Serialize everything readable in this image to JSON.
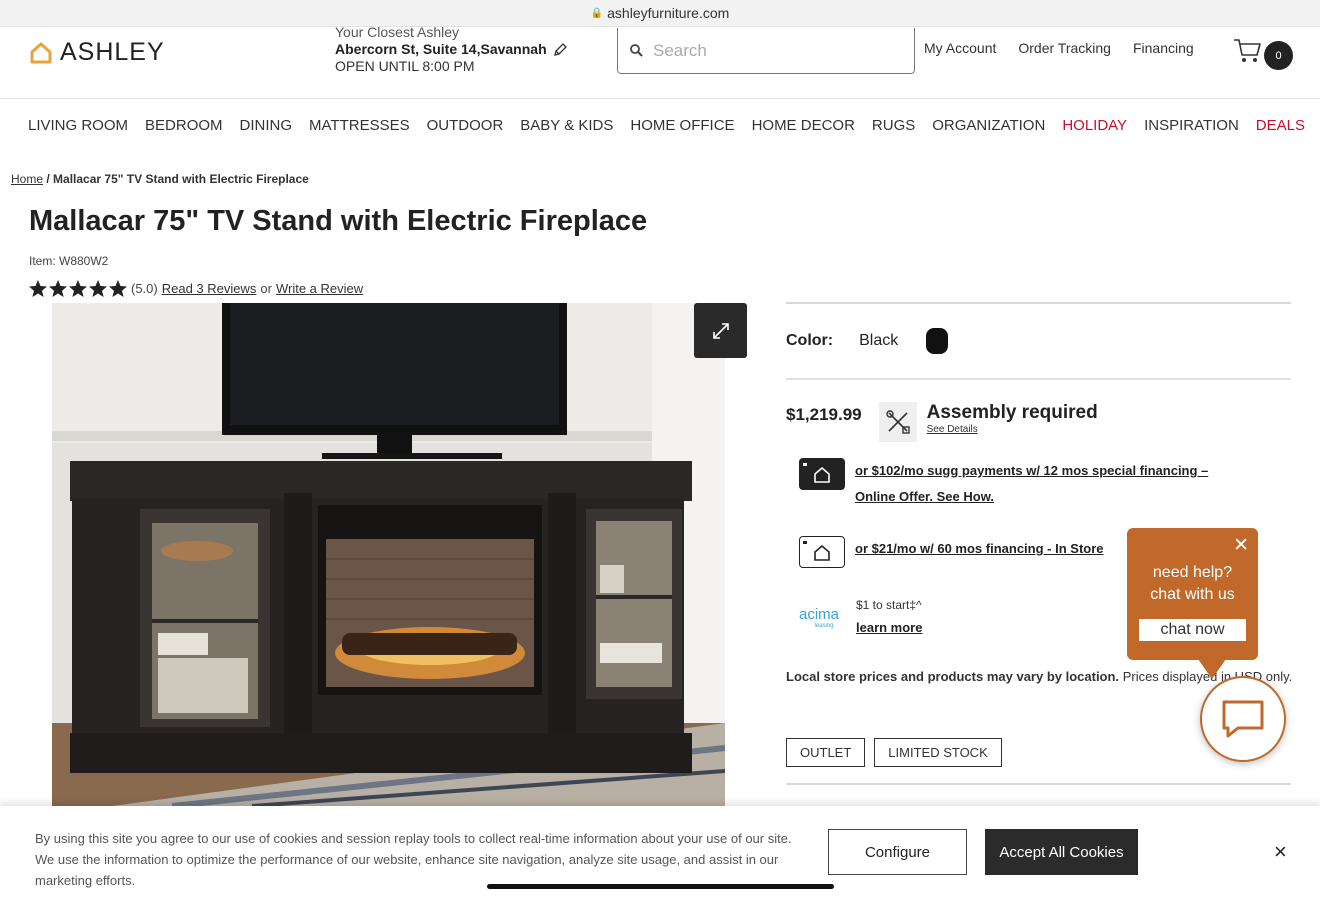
{
  "browser": {
    "url": "ashleyfurniture.com"
  },
  "header": {
    "brand": "ASHLEY",
    "store_label": "Your Closest Ashley",
    "store_address": "Abercorn St, Suite 14,Savannah",
    "store_hours": "OPEN UNTIL 8:00 PM",
    "search_placeholder": "Search",
    "links": [
      "My Account",
      "Order Tracking",
      "Financing"
    ],
    "cart_count": "0"
  },
  "nav": {
    "items": [
      "LIVING ROOM",
      "BEDROOM",
      "DINING",
      "MATTRESSES",
      "OUTDOOR",
      "BABY & KIDS",
      "HOME OFFICE",
      "HOME DECOR",
      "RUGS",
      "ORGANIZATION",
      "HOLIDAY",
      "INSPIRATION",
      "DEALS"
    ],
    "highlight_color": "#c8102e"
  },
  "breadcrumb": {
    "home": "Home",
    "separator": "/",
    "current": "Mallacar 75\" TV Stand with Electric Fireplace"
  },
  "product": {
    "title": "Mallacar 75\" TV Stand with Electric Fireplace",
    "item": "Item: W880W2",
    "rating_value": 5,
    "rating_text": "(5.0)",
    "reviews_link": "Read 3 Reviews",
    "or_text": "or",
    "write_review": "Write a Review",
    "color_label": "Color:",
    "color_value": "Black",
    "price": "$1,219.99",
    "assembly": "Assembly required",
    "assembly_details": "See Details",
    "financing_1_line1": "or $102/mo sugg payments w/ 12 mos special financing –",
    "financing_1_line2": "Online Offer. See How.",
    "financing_2": "or $21/mo w/ 60 mos financing - In Store",
    "acima_logo": "acima",
    "acima_sub": "leasing",
    "acima_start": "$1 to start‡^",
    "acima_link": "learn more",
    "local_bold": "Local store prices and products may vary by location.",
    "local_rest": "Prices displayed in USD only.",
    "tags": [
      "OUTLET",
      "LIMITED STOCK"
    ]
  },
  "chat": {
    "message_line1": "need help?",
    "message_line2": "chat with us",
    "button": "chat now",
    "accent": "#c0692a"
  },
  "cookie": {
    "text": "By using this site you agree to our use of cookies and session replay tools to collect real-time information about your use of our site. We use the information to optimize the performance of our website, enhance site navigation, analyze site usage, and assist in our marketing efforts.",
    "configure": "Configure",
    "accept": "Accept All Cookies",
    "close": "×"
  }
}
